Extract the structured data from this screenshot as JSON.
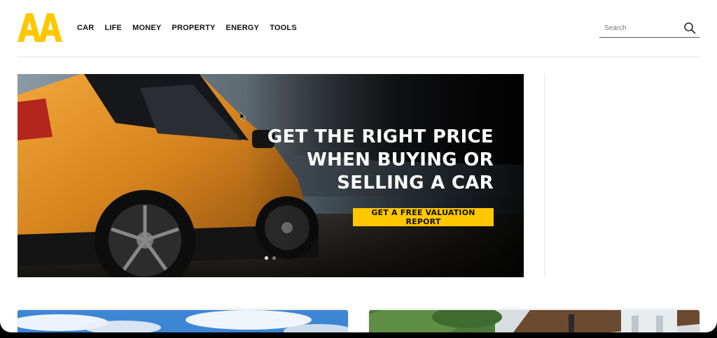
{
  "brand": {
    "logo_text": "AA",
    "accent": "#ffc700"
  },
  "nav": {
    "items": [
      {
        "label": "CAR"
      },
      {
        "label": "LIFE"
      },
      {
        "label": "MONEY"
      },
      {
        "label": "PROPERTY"
      },
      {
        "label": "ENERGY"
      },
      {
        "label": "TOOLS"
      }
    ]
  },
  "search": {
    "placeholder": "Search",
    "icon": "search-icon"
  },
  "hero": {
    "headline_lines": [
      "GET THE RIGHT PRICE",
      "WHEN BUYING OR",
      "SELLING A CAR"
    ],
    "cta_label": "GET A FREE VALUATION REPORT",
    "slides_total": 2,
    "active_slide": 1
  },
  "cards": [
    {
      "image": "sky-with-clouds"
    },
    {
      "image": "house-with-trees"
    }
  ]
}
